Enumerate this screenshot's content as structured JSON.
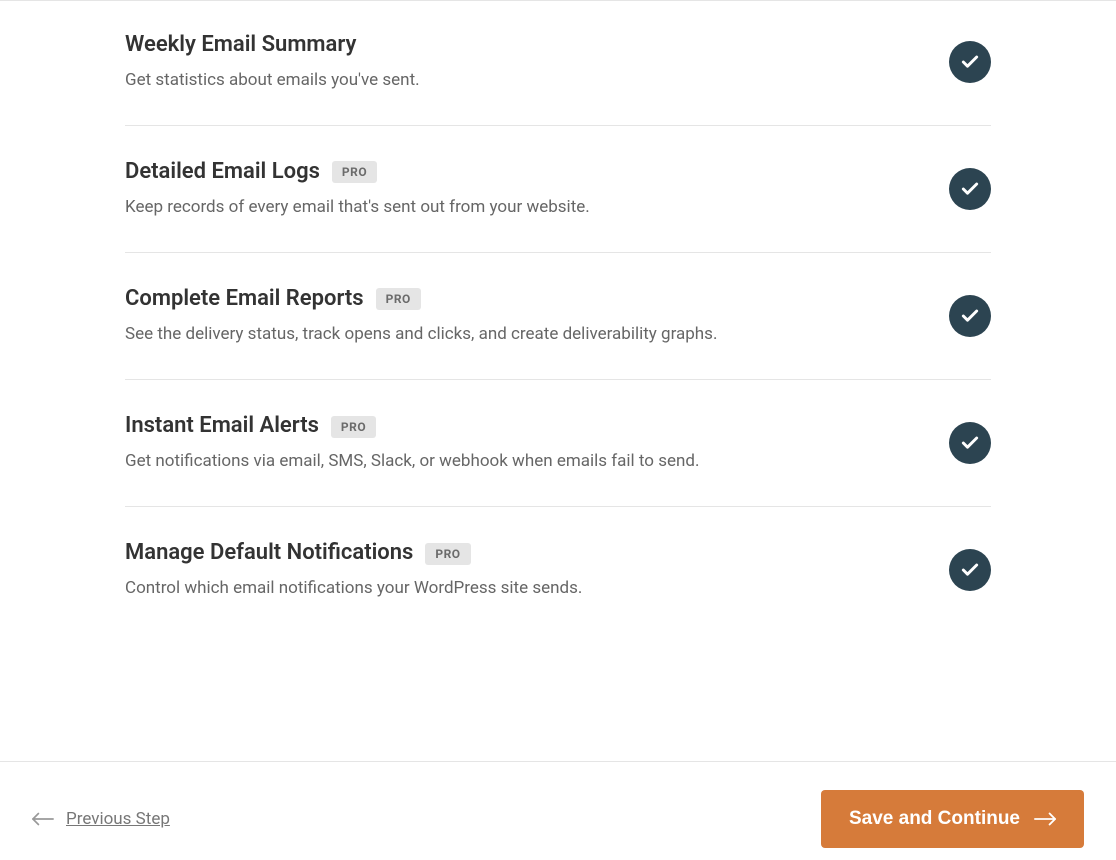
{
  "badges": {
    "pro": "PRO"
  },
  "features": [
    {
      "title": "Weekly Email Summary",
      "desc": "Get statistics about emails you've sent.",
      "pro": false
    },
    {
      "title": "Detailed Email Logs",
      "desc": "Keep records of every email that's sent out from your website.",
      "pro": true
    },
    {
      "title": "Complete Email Reports",
      "desc": "See the delivery status, track opens and clicks, and create deliverability graphs.",
      "pro": true
    },
    {
      "title": "Instant Email Alerts",
      "desc": "Get notifications via email, SMS, Slack, or webhook when emails fail to send.",
      "pro": true
    },
    {
      "title": "Manage Default Notifications",
      "desc": "Control which email notifications your WordPress site sends.",
      "pro": true
    }
  ],
  "footer": {
    "prev_label": "Previous Step",
    "save_label": "Save and Continue"
  }
}
